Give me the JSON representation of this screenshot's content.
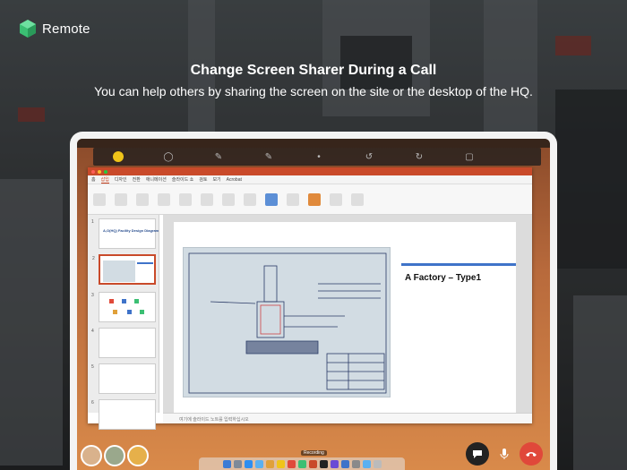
{
  "app": {
    "logo_text": "Remote"
  },
  "headline": "Change Screen Sharer During a Call",
  "subline": "You can help others by sharing the screen on the site or the desktop of the HQ.",
  "slide": {
    "label": "A Factory – Type1"
  },
  "thumbnails": [
    {
      "num": "1",
      "title": "A,O(HQ) Facility Design Diagram"
    },
    {
      "num": "2",
      "title": ""
    },
    {
      "num": "3",
      "title": ""
    },
    {
      "num": "4",
      "title": ""
    },
    {
      "num": "5",
      "title": ""
    },
    {
      "num": "6",
      "title": ""
    }
  ],
  "ppt": {
    "tabs": [
      "홈",
      "삽입",
      "디자인",
      "전환",
      "애니메이션",
      "슬라이드 쇼",
      "검토",
      "보기",
      "Acrobat"
    ],
    "notes_placeholder": "여기에 슬라이드 노트를 입력하십시오"
  },
  "dock": {
    "recording_label": "Recording"
  },
  "colors": {
    "accent": "#3f73c9",
    "end_call": "#e0483a",
    "ppt_red": "#c94a2a",
    "logo_green": "#3bbf73"
  }
}
